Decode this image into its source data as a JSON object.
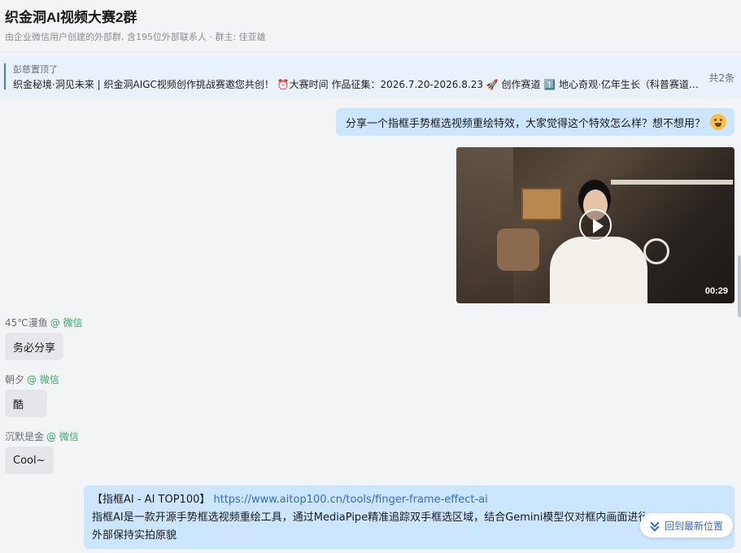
{
  "header": {
    "title": "织金洞AI视频大赛2群",
    "subtitle": "由企业微信用户创建的外部群, 含195位外部联系人 · 群主: 佳亚雄"
  },
  "pinned": {
    "label": "彭慈置顶了",
    "text": "织金秘境·洞见未来 | 织金洞AIGC视频创作挑战赛邀您共创！ ⏰大赛时间 作品征集：2026.7.20-2026.8.23 🚀 创作赛道 1️⃣ 地心奇观·亿年生长（科普赛道…",
    "count": "共2条"
  },
  "messages": {
    "outgoing_text": "分享一个指框手势框选视频重绘特效，大家觉得这个特效怎么样？想不想用？",
    "video_duration": "00:29",
    "incoming": [
      {
        "name": "45℃漫鱼",
        "source": "@ 微信",
        "text": "务必分享"
      },
      {
        "name": "朝夕",
        "source": "@ 微信",
        "text": "酷"
      },
      {
        "name": "沉默是金",
        "source": "@ 微信",
        "text": "Cool~"
      }
    ],
    "link_card": {
      "title": "【指框AI - AI TOP100】",
      "url": "https://www.aitop100.cn/tools/finger-frame-effect-ai",
      "line2": "指框AI是一款开源手势框选视频重绘工具，通过MediaPipe精准追踪双手框选区域，结合Gemini模型仅对框内画面进行",
      "line3": "外部保持实拍原貌"
    }
  },
  "back_to_latest": "回到最新位置"
}
